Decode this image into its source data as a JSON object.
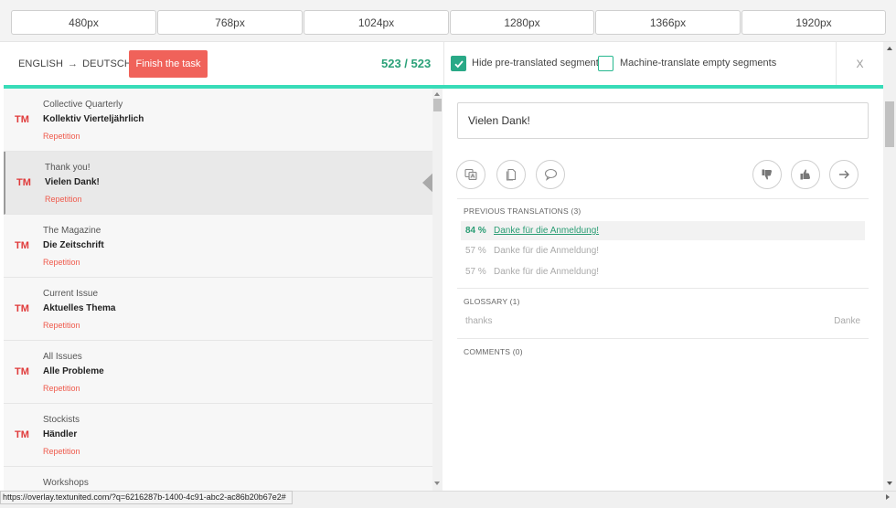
{
  "viewport_buttons": [
    "480px",
    "768px",
    "1024px",
    "1280px",
    "1366px",
    "1920px"
  ],
  "header": {
    "source_lang": "ENGLISH",
    "arrow": "→",
    "target_lang": "DEUTSCH",
    "finish_label": "Finish the task",
    "progress": "523 / 523",
    "hide_pretranslated_label": "Hide pre-translated segments",
    "hide_pretranslated_checked": true,
    "machine_translate_label": "Machine-translate empty segments",
    "machine_translate_checked": false,
    "close_label": "X"
  },
  "segments": [
    {
      "badge": "TM",
      "source": "Collective Quarterly",
      "target": "Kollektiv Vierteljährlich",
      "status": "Repetition",
      "active": false
    },
    {
      "badge": "TM",
      "source": "Thank you!",
      "target": "Vielen Dank!",
      "status": "Repetition",
      "active": true
    },
    {
      "badge": "TM",
      "source": "The Magazine",
      "target": "Die Zeitschrift",
      "status": "Repetition",
      "active": false
    },
    {
      "badge": "TM",
      "source": "Current Issue",
      "target": "Aktuelles Thema",
      "status": "Repetition",
      "active": false
    },
    {
      "badge": "TM",
      "source": "All Issues",
      "target": "Alle Probleme",
      "status": "Repetition",
      "active": false
    },
    {
      "badge": "TM",
      "source": "Stockists",
      "target": "Händler",
      "status": "Repetition",
      "active": false
    },
    {
      "badge": "",
      "source": "Workshops",
      "target": "",
      "status": "",
      "active": false
    }
  ],
  "editor": {
    "translation_value": "Vielen Dank!"
  },
  "toolbar_icons": {
    "left": [
      "translate-icon",
      "copy-icon",
      "comment-icon"
    ],
    "right": [
      "thumbs-down-icon",
      "thumbs-up-icon",
      "arrow-right-icon"
    ]
  },
  "previous_translations": {
    "title": "PREVIOUS TRANSLATIONS (3)",
    "items": [
      {
        "percent": "84 %",
        "text": "Danke für die Anmeldung!",
        "highlight": true
      },
      {
        "percent": "57 %",
        "text": "Danke für die Anmeldung!",
        "highlight": false
      },
      {
        "percent": "57 %",
        "text": "Danke für die Anmeldung!",
        "highlight": false
      }
    ]
  },
  "glossary": {
    "title": "GLOSSARY (1)",
    "term": "thanks",
    "translation": "Danke"
  },
  "comments": {
    "title": "COMMENTS (0)"
  },
  "status_url": "https://overlay.textunited.com/?q=6216287b-1400-4c91-abc2-ac86b20b67e2#",
  "colors": {
    "accent_teal": "#38dcb8",
    "progress_green": "#2aa178",
    "finish_red": "#f0625a",
    "tm_red": "#e03a3a"
  }
}
